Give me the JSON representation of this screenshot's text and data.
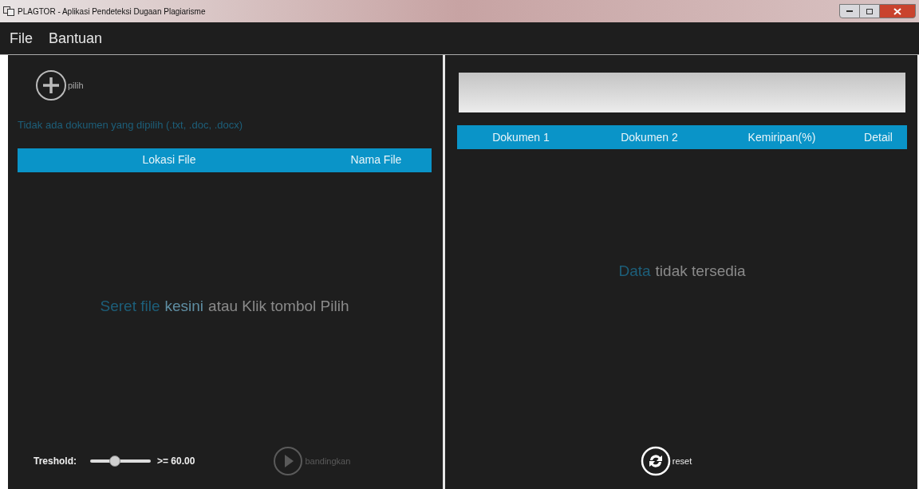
{
  "window": {
    "title": "PLAGTOR - Aplikasi Pendeteksi Dugaan Plagiarisme"
  },
  "menu": [
    "File",
    "Bantuan"
  ],
  "left": {
    "pick_button": "pilih",
    "status": "Tidak ada dokumen yang dipilih (.txt, .doc, .docx)",
    "columns": [
      "Lokasi File",
      "Nama File"
    ],
    "empty_message": [
      {
        "text": "Seret file",
        "color": "#1d5f7a"
      },
      {
        "text": "kesini",
        "color": "#5f8ea3"
      },
      {
        "text": "atau Klik tombol Pilih",
        "color": "#8a8a8a"
      }
    ],
    "threshold": {
      "label": "Treshold:",
      "level": 0.4,
      "reading": ">= 60.00"
    },
    "compare_button": {
      "label": "bandingkan",
      "disabled": true
    }
  },
  "right": {
    "columns": [
      "Dokumen 1",
      "Dokumen 2",
      "Kemiripan(%)",
      "Detail"
    ],
    "empty_message": [
      {
        "text": "Data",
        "color": "#1d5f7a"
      },
      {
        "text": "tidak tersedia",
        "color": "#8a8a8a"
      }
    ],
    "reset_button": "reset"
  }
}
